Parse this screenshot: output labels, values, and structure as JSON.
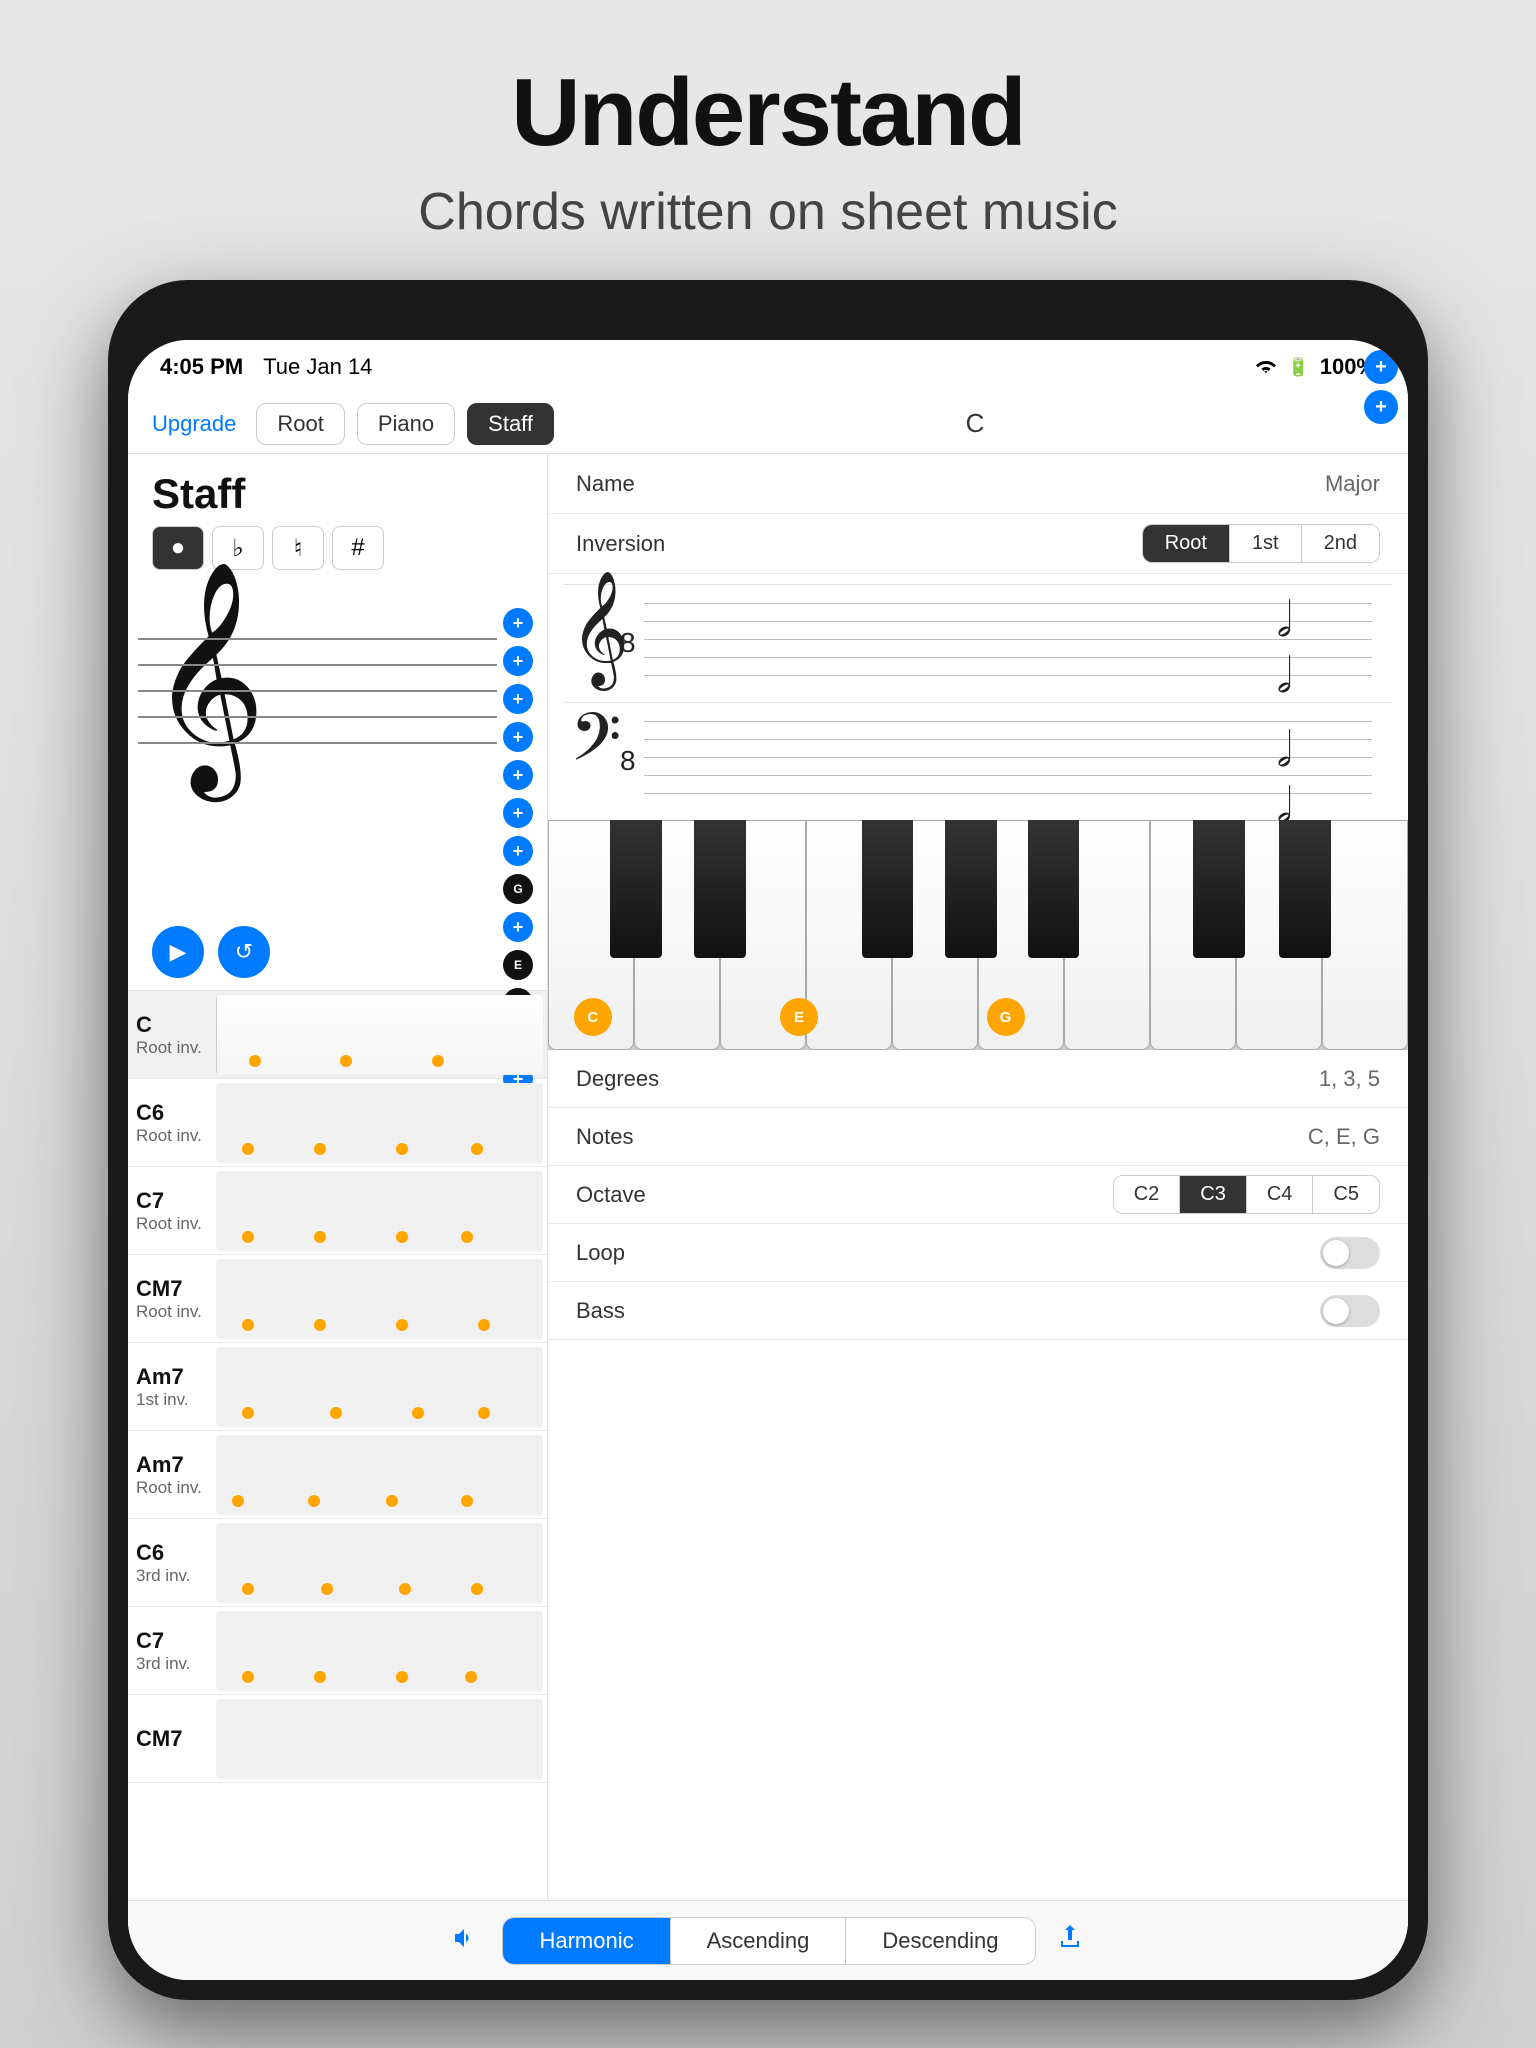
{
  "header": {
    "title": "Understand",
    "subtitle": "Chords written on sheet music"
  },
  "status_bar": {
    "time": "4:05 PM",
    "date": "Tue Jan 14",
    "battery": "100%"
  },
  "nav": {
    "upgrade": "Upgrade",
    "tabs": [
      "Root",
      "Piano",
      "Staff"
    ],
    "active_tab": "Staff",
    "center_label": "C"
  },
  "left_panel": {
    "title": "Staff",
    "accidentals": [
      "●",
      "♭",
      "♮",
      "#"
    ],
    "active_accidental": 0
  },
  "note_labels": [
    "G",
    "E",
    "C"
  ],
  "playback": {
    "play_label": "▶",
    "reset_label": "↺"
  },
  "chord_list": [
    {
      "name": "C",
      "inv": "Root inv.",
      "selected": true
    },
    {
      "name": "C6",
      "inv": "Root inv.",
      "selected": false
    },
    {
      "name": "C7",
      "inv": "Root inv.",
      "selected": false
    },
    {
      "name": "CM7",
      "inv": "Root inv.",
      "selected": false
    },
    {
      "name": "Am7",
      "inv": "1st inv.",
      "selected": false
    },
    {
      "name": "Am7",
      "inv": "Root inv.",
      "selected": false
    },
    {
      "name": "C6",
      "inv": "3rd inv.",
      "selected": false
    },
    {
      "name": "C7",
      "inv": "3rd inv.",
      "selected": false
    },
    {
      "name": "CM7",
      "inv": "",
      "selected": false
    }
  ],
  "right_panel": {
    "name_label": "Name",
    "name_value": "Major",
    "inversion_label": "Inversion",
    "inversion_options": [
      "Root",
      "1st",
      "2nd"
    ],
    "active_inversion": "Root",
    "degrees_label": "Degrees",
    "degrees_value": "1, 3, 5",
    "notes_label": "Notes",
    "notes_value": "C, E, G",
    "octave_label": "Octave",
    "octave_options": [
      "C2",
      "C3",
      "C4",
      "C5"
    ],
    "active_octave": "C3",
    "loop_label": "Loop",
    "bass_label": "Bass",
    "piano_notes": [
      "C",
      "E",
      "G"
    ]
  },
  "bottom_bar": {
    "modes": [
      "Harmonic",
      "Ascending",
      "Descending"
    ],
    "active_mode": "Harmonic"
  }
}
